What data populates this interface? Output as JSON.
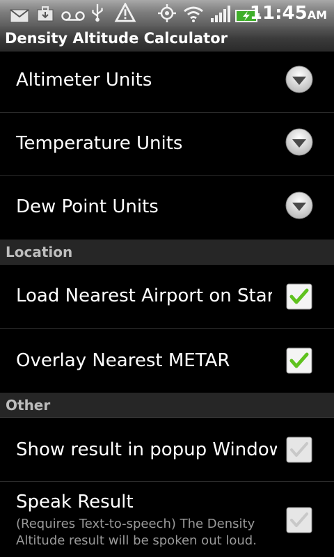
{
  "status_bar": {
    "time": "11:45",
    "ampm": "AM",
    "icons": [
      "mail-icon",
      "briefcase-download-icon",
      "voicemail-icon",
      "usb-icon",
      "warning-icon",
      "gps-icon",
      "wifi-icon",
      "signal-icon",
      "battery-charging-icon"
    ]
  },
  "title": "Density Altitude Calculator",
  "units": {
    "altimeter_label": "Altimeter Units",
    "temperature_label": "Temperature Units",
    "dewpoint_label": "Dew Point Units"
  },
  "location": {
    "header": "Location",
    "load_nearest_label": "Load Nearest Airport on Startup",
    "load_nearest_checked": true,
    "overlay_metar_label": "Overlay Nearest METAR",
    "overlay_metar_checked": true
  },
  "other": {
    "header": "Other",
    "popup_label": "Show result in popup Window",
    "popup_checked": false,
    "speak_label": "Speak Result",
    "speak_summary_line1": "(Requires Text-to-speech) The Density",
    "speak_summary_line2": "Altitude result will be spoken out loud.",
    "speak_checked": false
  },
  "colors": {
    "check_green": "#5fc21e",
    "section_bg": "#262626"
  }
}
